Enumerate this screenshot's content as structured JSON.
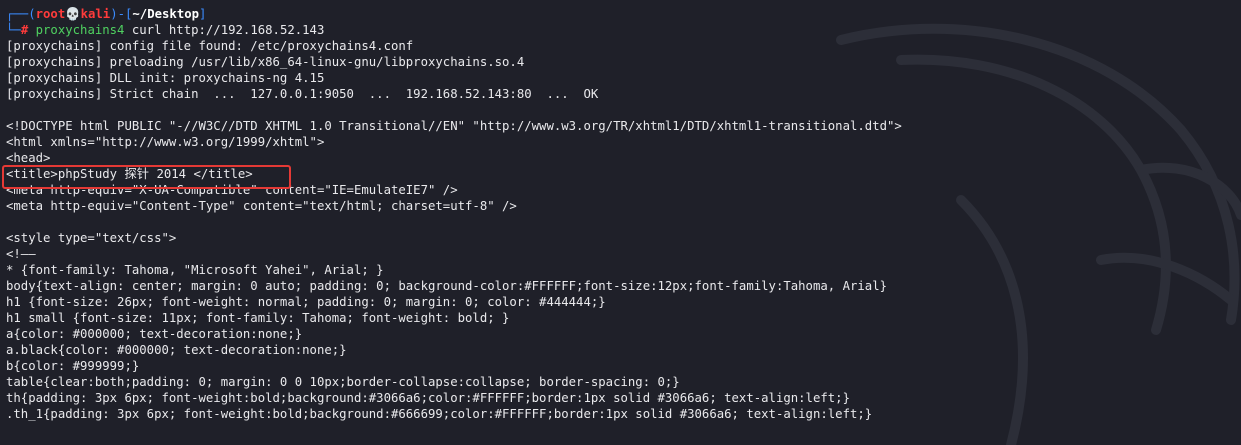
{
  "prompt": {
    "frame_top_left": "┌──(",
    "user": "root",
    "skull": "💀",
    "host": "kali",
    "frame_mid": ")-[",
    "dir": "~/Desktop",
    "frame_end": "]",
    "frame_bottom": "└─",
    "hash": "#",
    "command": "proxychains4",
    "args": " curl http://192.168.52.143"
  },
  "proxychains_lines": [
    "[proxychains] config file found: /etc/proxychains4.conf",
    "[proxychains] preloading /usr/lib/x86_64-linux-gnu/libproxychains.so.4",
    "[proxychains] DLL init: proxychains-ng 4.15",
    "[proxychains] Strict chain  ...  127.0.0.1:9050  ...  192.168.52.143:80  ...  OK"
  ],
  "html_head_lines": [
    "<!DOCTYPE html PUBLIC \"-//W3C//DTD XHTML 1.0 Transitional//EN\" \"http://www.w3.org/TR/xhtml1/DTD/xhtml1-transitional.dtd\">",
    "<html xmlns=\"http://www.w3.org/1999/xhtml\">",
    "<head>",
    "<title>phpStudy 探针 2014 </title>",
    "<meta http-equiv=\"X-UA-Compatible\" content=\"IE=EmulateIE7\" />",
    "<meta http-equiv=\"Content-Type\" content=\"text/html; charset=utf-8\" />"
  ],
  "css_lines": [
    "<style type=\"text/css\">",
    "<!——",
    "* {font-family: Tahoma, \"Microsoft Yahei\", Arial; }",
    "body{text-align: center; margin: 0 auto; padding: 0; background-color:#FFFFFF;font-size:12px;font-family:Tahoma, Arial}",
    "h1 {font-size: 26px; font-weight: normal; padding: 0; margin: 0; color: #444444;}",
    "h1 small {font-size: 11px; font-family: Tahoma; font-weight: bold; }",
    "a{color: #000000; text-decoration:none;}",
    "a.black{color: #000000; text-decoration:none;}",
    "b{color: #999999;}",
    "table{clear:both;padding: 0; margin: 0 0 10px;border-collapse:collapse; border-spacing: 0;}",
    "th{padding: 3px 6px; font-weight:bold;background:#3066a6;color:#FFFFFF;border:1px solid #3066a6; text-align:left;}",
    ".th_1{padding: 3px 6px; font-weight:bold;background:#666699;color:#FFFFFF;border:1px solid #3066a6; text-align:left;}"
  ],
  "colors": {
    "background": "#1f2029",
    "text": "#e9e9ec",
    "prompt_frame": "#3b8cff",
    "prompt_user": "#ff3b3b",
    "command": "#4fd160",
    "highlight_box": "#e53935"
  },
  "icons": {
    "watermark": "kali-dragon-icon",
    "skull": "skull-icon"
  }
}
